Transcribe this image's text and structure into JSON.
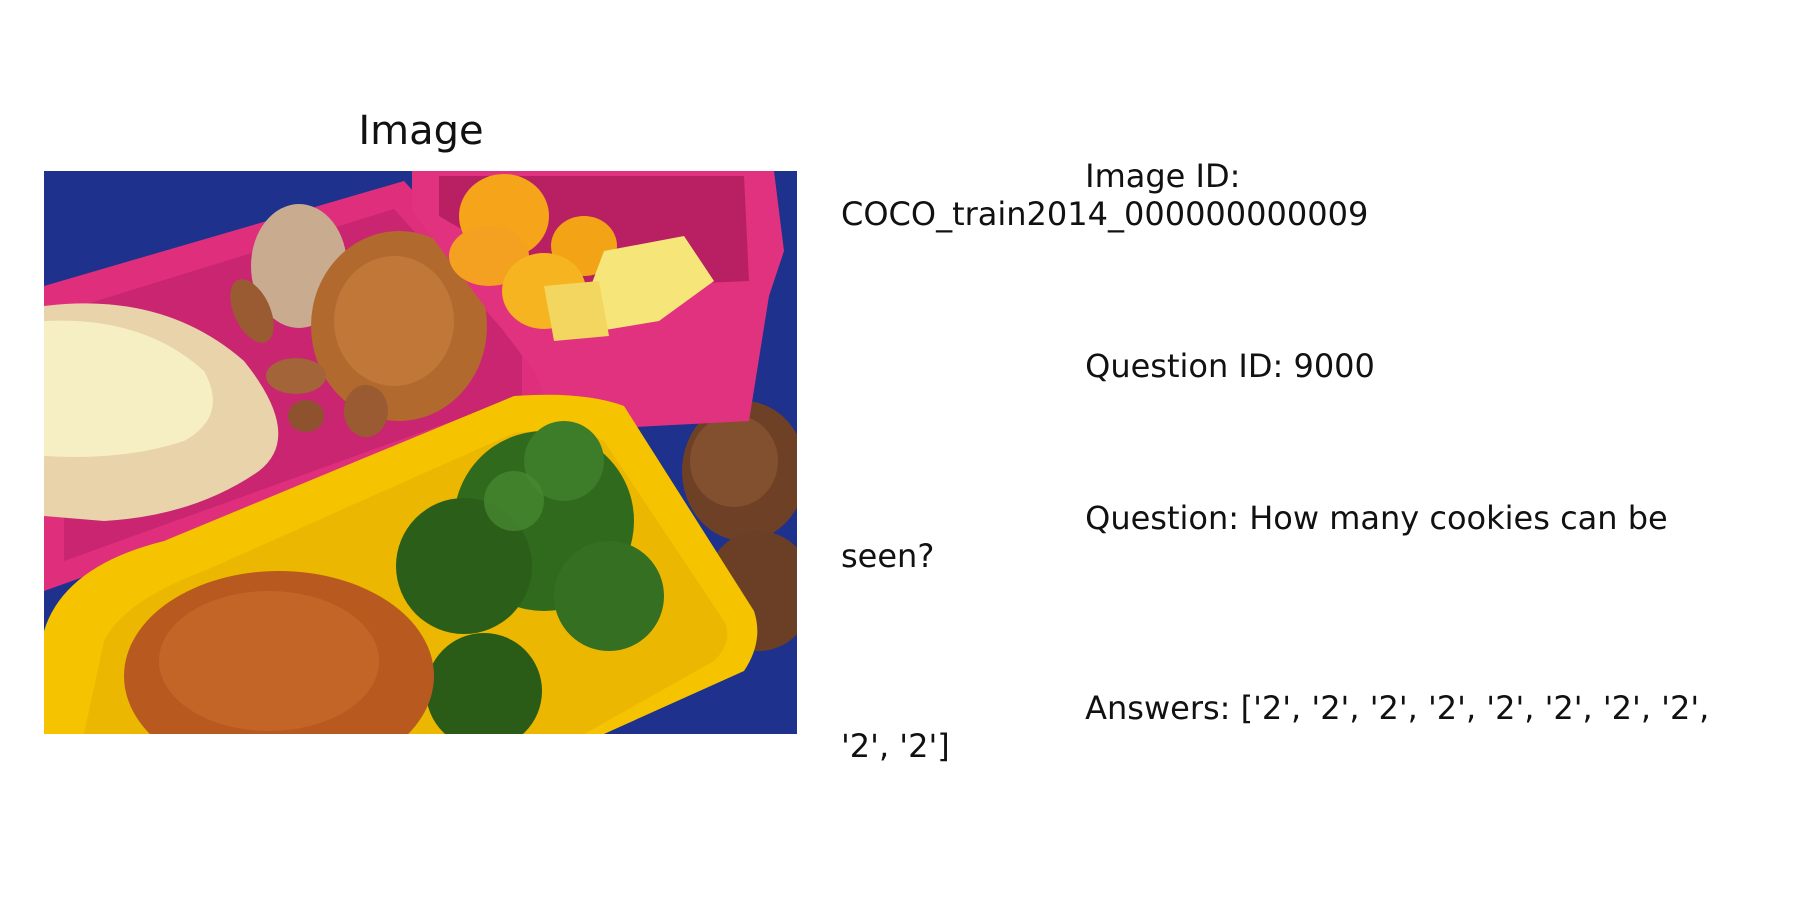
{
  "image_panel": {
    "title": "Image",
    "photo_subject": "bento lunch box with bread, almonds, dried fruit, orange slices, pineapple, broccoli, a meatball and cookies"
  },
  "info_panel": {
    "image_id": "                        Image ID:\nCOCO_train2014_000000000009",
    "question_id": "                        Question ID: 9000",
    "question": "                        Question: How many cookies can be\nseen?",
    "answers": "                        Answers: ['2', '2', '2', '2', '2', '2', '2', '2',\n'2', '2']"
  },
  "colors": {
    "box_blue": "#1a2f8a",
    "tray_pink": "#e0307f",
    "tray_yellow": "#f4c400",
    "broccoli_green": "#2f6b1e",
    "meatball_orange": "#b5561e",
    "cookie_brown": "#7a4a2b"
  }
}
